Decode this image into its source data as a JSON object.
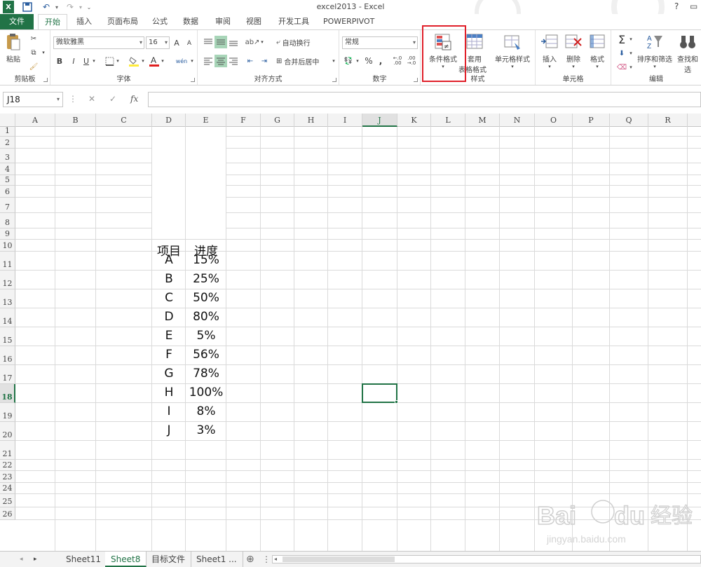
{
  "window": {
    "title": "excel2013 - Excel",
    "help": "?"
  },
  "tabs": [
    {
      "label": "文件"
    },
    {
      "label": "开始"
    },
    {
      "label": "插入"
    },
    {
      "label": "页面布局"
    },
    {
      "label": "公式"
    },
    {
      "label": "数据"
    },
    {
      "label": "审阅"
    },
    {
      "label": "视图"
    },
    {
      "label": "开发工具"
    },
    {
      "label": "POWERPIVOT"
    }
  ],
  "ribbon": {
    "clipboard": {
      "paste": "粘贴",
      "group": "剪贴板"
    },
    "font": {
      "name": "微软雅黑",
      "size": "16",
      "bold": "B",
      "italic": "I",
      "underline": "U",
      "grow": "A",
      "shrink": "A",
      "phonetic": "wén",
      "group": "字体"
    },
    "alignment": {
      "wrap": "自动换行",
      "merge": "合并后居中",
      "group": "对齐方式"
    },
    "number": {
      "format": "常规",
      "percent": "%",
      "comma": ",",
      "group": "数字"
    },
    "styles": {
      "conditional": "条件格式",
      "table_line1": "套用",
      "table_line2": "表格格式",
      "cell_styles": "单元格样式",
      "group": "样式"
    },
    "cells": {
      "insert": "插入",
      "delete": "删除",
      "format": "格式",
      "group": "单元格"
    },
    "editing": {
      "sum": "Σ",
      "sort": "排序和筛选",
      "find": "查找和选",
      "group": "编辑"
    }
  },
  "formula_bar": {
    "name_box": "J18",
    "fx": "fx",
    "value": ""
  },
  "columns": [
    "A",
    "B",
    "C",
    "D",
    "E",
    "F",
    "G",
    "H",
    "I",
    "J",
    "K",
    "L",
    "M",
    "N",
    "O",
    "P",
    "Q",
    "R"
  ],
  "selected_column": "J",
  "selected_row": "18",
  "table": {
    "headers": [
      "项目",
      "进度"
    ],
    "rows": [
      [
        "A",
        "15%"
      ],
      [
        "B",
        "25%"
      ],
      [
        "C",
        "50%"
      ],
      [
        "D",
        "80%"
      ],
      [
        "E",
        "5%"
      ],
      [
        "F",
        "56%"
      ],
      [
        "G",
        "78%"
      ],
      [
        "H",
        "100%"
      ],
      [
        "I",
        "8%"
      ],
      [
        "J",
        "3%"
      ]
    ]
  },
  "sheets": [
    {
      "label": "Sheet11",
      "active": false
    },
    {
      "label": "Sheet8",
      "active": true
    },
    {
      "label": "目标文件",
      "active": false
    },
    {
      "label": "Sheet1 ...",
      "active": false
    }
  ],
  "watermark": {
    "brand": "Bai",
    "brand2": "du",
    "cn": "经验",
    "url": "jingyan.baidu.com"
  }
}
